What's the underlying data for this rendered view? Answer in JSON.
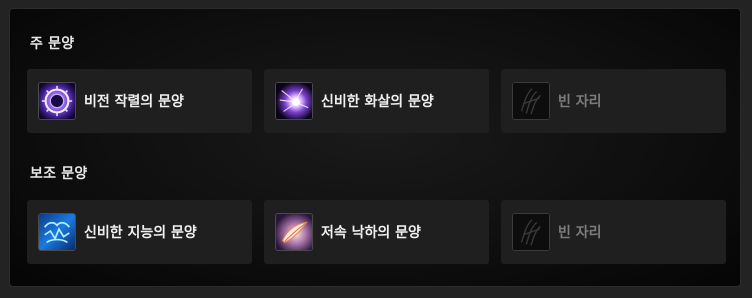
{
  "primary": {
    "title": "주 문양",
    "slots": [
      {
        "label": "비전 작렬의 문양",
        "icon": "arcane-blast-glyph-icon"
      },
      {
        "label": "신비한 화살의 문양",
        "icon": "arcane-missiles-glyph-icon"
      },
      {
        "label": "빈 자리",
        "icon": "empty-slot-icon"
      }
    ]
  },
  "secondary": {
    "title": "보조 문양",
    "slots": [
      {
        "label": "신비한 지능의 문양",
        "icon": "arcane-intellect-glyph-icon"
      },
      {
        "label": "저속 낙하의 문양",
        "icon": "slow-fall-glyph-icon"
      },
      {
        "label": "빈 자리",
        "icon": "empty-slot-icon"
      }
    ]
  },
  "colors": {
    "slot_bg": "#1f1f1f",
    "label": "#f0f0f0",
    "empty_label": "#7c7c7c"
  }
}
